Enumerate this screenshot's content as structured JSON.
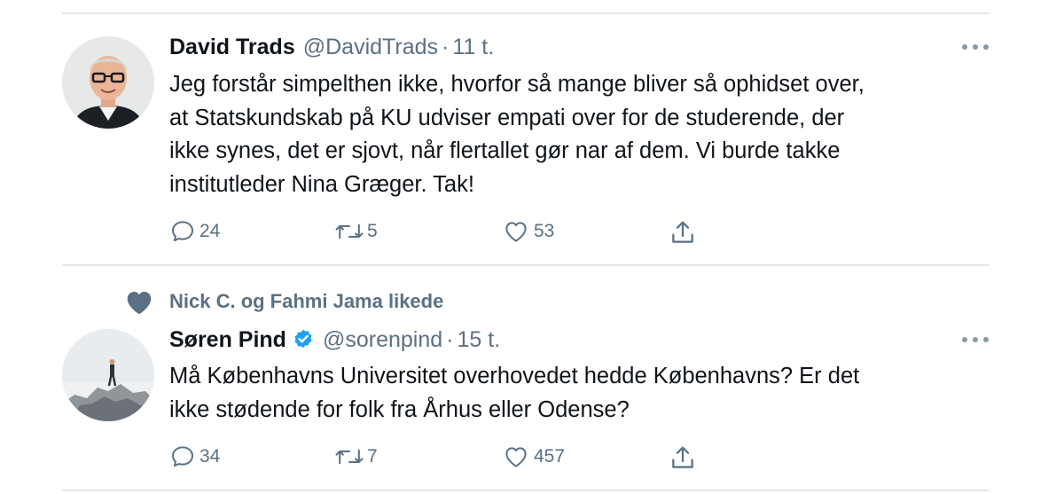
{
  "tweets": [
    {
      "author": "David Trads",
      "handle": "@DavidTrads",
      "separator": "·",
      "time": "11 t.",
      "text": "Jeg forstår simpelthen ikke, hvorfor så mange bliver så ophidset over, at Statskundskab på KU udviser empati over for de studerende, der ikke synes, det er sjovt, når flertallet gør nar af dem. Vi burde takke institutleder Nina Græger. Tak!",
      "lines": [
        "Jeg forstår simpelthen ikke, hvorfor så mange bliver så ophidset over,",
        "at Statskundskab på KU udviser empati over for de studerende, der",
        "ikke synes, det er sjovt, når flertallet gør nar af dem. Vi burde takke",
        "institutleder Nina Græger. Tak!"
      ],
      "replies": "24",
      "retweets": "5",
      "likes": "53"
    },
    {
      "social_context": "Nick C. og Fahmi Jama likede",
      "author": "Søren Pind",
      "verified": true,
      "handle": "@sorenpind",
      "separator": "·",
      "time": "15 t.",
      "lines": [
        "Må Københavns Universitet overhovedet hedde Københavns? Er det",
        "ikke stødende for folk fra Århus eller Odense?"
      ],
      "replies": "34",
      "retweets": "7",
      "likes": "457"
    }
  ],
  "icons": {
    "reply": "reply-icon",
    "retweet": "retweet-icon",
    "like": "like-icon",
    "share": "share-icon",
    "more": "more-icon",
    "verified": "verified-badge-icon",
    "liked": "liked-heart-icon"
  },
  "colors": {
    "text": "#0f1419",
    "secondary": "#5b7083",
    "divider": "#e3e6e9",
    "verified": "#1da1f2"
  }
}
